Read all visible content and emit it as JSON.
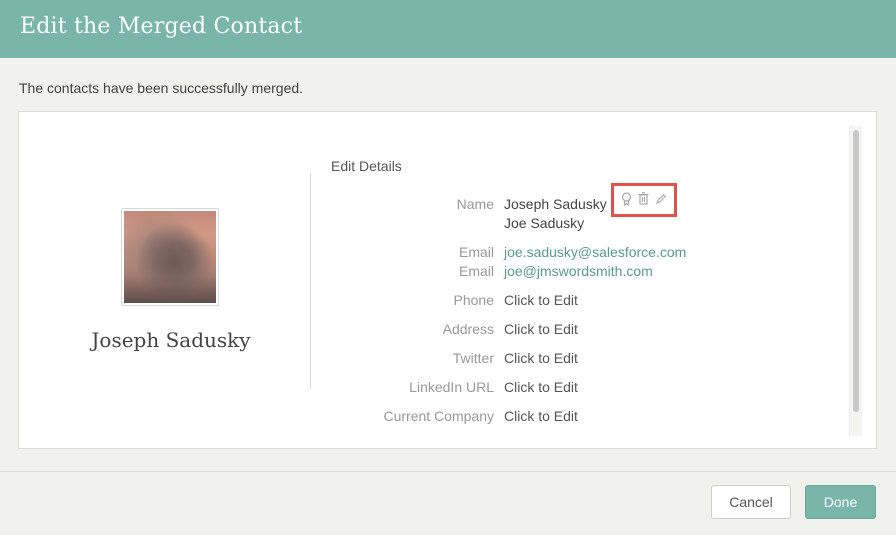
{
  "dialog": {
    "title": "Edit the Merged Contact",
    "message": "The contacts have been successfully merged."
  },
  "contact": {
    "display_name": "Joseph Sadusky"
  },
  "details": {
    "section_title": "Edit Details",
    "name_label": "Name",
    "name_values": [
      "Joseph Sadusky",
      "Joe Sadusky"
    ],
    "email_label": "Email",
    "emails": [
      "joe.sadusky@salesforce.com",
      "joe@jmswordsmith.com"
    ],
    "phone_label": "Phone",
    "address_label": "Address",
    "twitter_label": "Twitter",
    "linkedin_label": "LinkedIn URL",
    "company_label": "Current Company",
    "placeholder": "Click to Edit"
  },
  "name_actions": {
    "icons": [
      "badge-icon",
      "trash-icon",
      "pencil-icon"
    ]
  },
  "buttons": {
    "cancel": "Cancel",
    "done": "Done"
  },
  "colors": {
    "accent": "#79b5a8",
    "link": "#5a9a8e",
    "highlight": "#e0524a"
  }
}
